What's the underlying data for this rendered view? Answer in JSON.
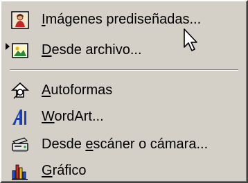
{
  "menu": {
    "items": [
      {
        "pre": "",
        "mn": "I",
        "post": "mágenes prediseñadas...",
        "icon": "clip-art-icon"
      },
      {
        "pre": "",
        "mn": "D",
        "post": "esde archivo...",
        "icon": "picture-file-icon"
      },
      {
        "pre": "",
        "mn": "A",
        "post": "utoformas",
        "icon": "autoshapes-icon"
      },
      {
        "pre": "",
        "mn": "W",
        "post": "ordArt...",
        "icon": "wordart-icon"
      },
      {
        "pre": "Desde ",
        "mn": "e",
        "post": "scáner o cámara...",
        "icon": "scanner-camera-icon"
      },
      {
        "pre": "",
        "mn": "G",
        "post": "ráfico",
        "icon": "chart-icon"
      }
    ]
  },
  "colors": {
    "menu_bg": "#d4d0c8",
    "highlight_shadow": "#808080"
  }
}
